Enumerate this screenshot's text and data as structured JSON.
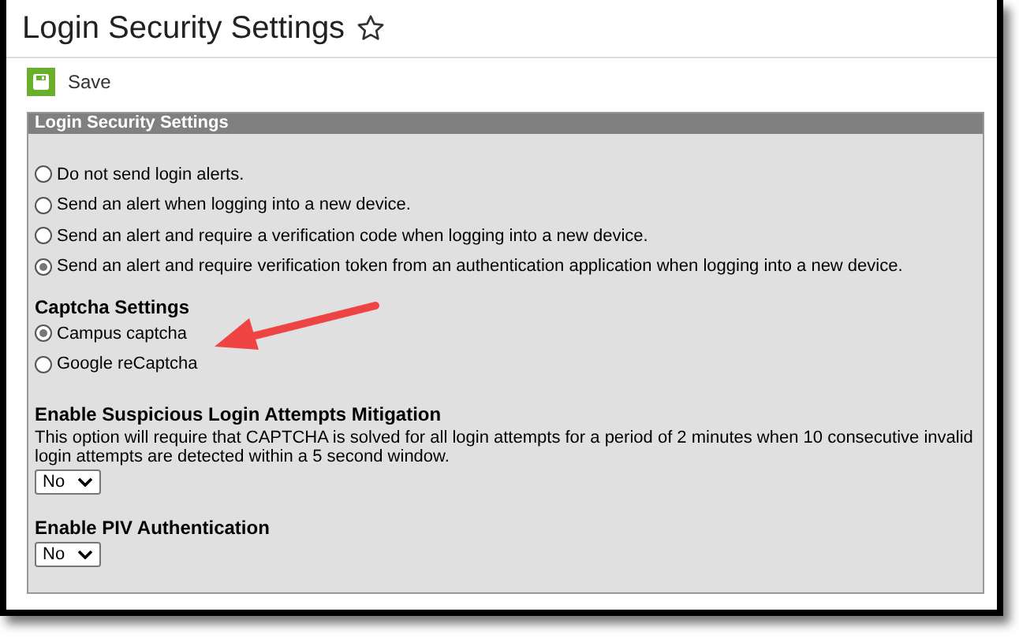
{
  "page": {
    "title": "Login Security Settings",
    "favorite": false
  },
  "toolbar": {
    "save_label": "Save"
  },
  "panel": {
    "header": "Login Security Settings",
    "alert_options": [
      {
        "label": "Do not send login alerts.",
        "selected": false
      },
      {
        "label": "Send an alert when logging into a new device.",
        "selected": false
      },
      {
        "label": "Send an alert and require a verification code when logging into a new device.",
        "selected": false
      },
      {
        "label": "Send an alert and require verification token from an authentication application when logging into a new device.",
        "selected": true
      }
    ],
    "captcha": {
      "heading": "Captcha Settings",
      "options": [
        {
          "label": "Campus captcha",
          "selected": true
        },
        {
          "label": "Google reCaptcha",
          "selected": false
        }
      ]
    },
    "mitigation": {
      "heading": "Enable Suspicious Login Attempts Mitigation",
      "description": "This option will require that CAPTCHA is solved for all login attempts for a period of 2 minutes when 10 consecutive invalid login attempts are detected within a 5 second window.",
      "value": "No"
    },
    "piv": {
      "heading": "Enable PIV Authentication",
      "value": "No"
    }
  }
}
